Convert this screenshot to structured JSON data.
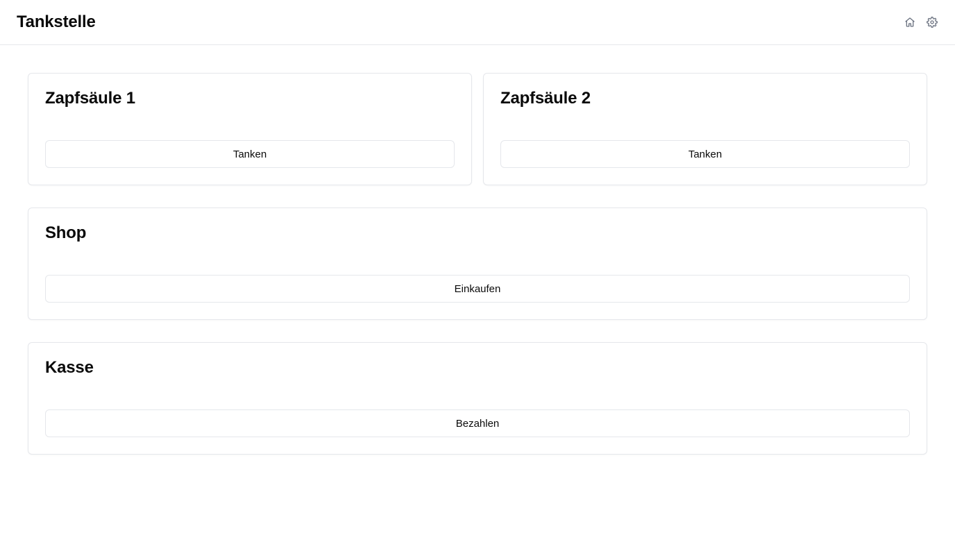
{
  "header": {
    "title": "Tankstelle",
    "icons": [
      "home-icon",
      "gear-icon"
    ]
  },
  "cards": {
    "pump1": {
      "title": "Zapfsäule 1",
      "button": "Tanken"
    },
    "pump2": {
      "title": "Zapfsäule 2",
      "button": "Tanken"
    },
    "shop": {
      "title": "Shop",
      "button": "Einkaufen"
    },
    "checkout": {
      "title": "Kasse",
      "button": "Bezahlen"
    }
  },
  "colors": {
    "border": "#e5e7eb",
    "text": "#0a0a0a",
    "icon": "#6b7280",
    "background": "#ffffff"
  }
}
